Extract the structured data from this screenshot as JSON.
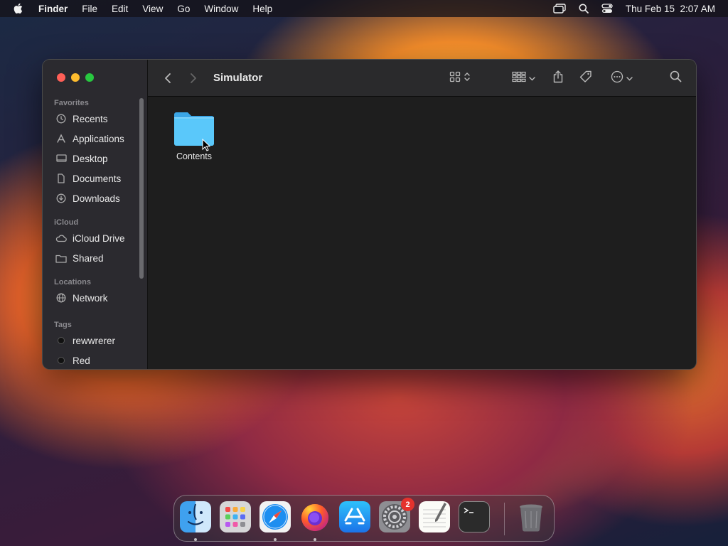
{
  "menubar": {
    "app_name": "Finder",
    "menus": [
      "File",
      "Edit",
      "View",
      "Go",
      "Window",
      "Help"
    ],
    "clock": "Thu Feb 15  2:07 AM",
    "status_icons": [
      "screen-mirroring-icon",
      "spotlight-icon",
      "control-center-icon"
    ]
  },
  "window": {
    "title": "Simulator",
    "sidebar": {
      "sections": [
        {
          "header": "Favorites",
          "items": [
            {
              "label": "Recents",
              "icon": "clock-icon"
            },
            {
              "label": "Applications",
              "icon": "applications-icon"
            },
            {
              "label": "Desktop",
              "icon": "desktop-icon"
            },
            {
              "label": "Documents",
              "icon": "document-icon"
            },
            {
              "label": "Downloads",
              "icon": "download-icon"
            }
          ]
        },
        {
          "header": "iCloud",
          "items": [
            {
              "label": "iCloud Drive",
              "icon": "cloud-icon"
            },
            {
              "label": "Shared",
              "icon": "shared-folder-icon"
            }
          ]
        },
        {
          "header": "Locations",
          "items": [
            {
              "label": "Network",
              "icon": "globe-icon"
            }
          ]
        },
        {
          "header": "Tags",
          "items": [
            {
              "label": "rewwrerer",
              "icon": "tag-dot"
            },
            {
              "label": "Red",
              "icon": "tag-dot"
            }
          ]
        }
      ]
    },
    "toolbar": {
      "icons": [
        "back-icon",
        "forward-icon",
        "icon-view-icon",
        "group-icon",
        "share-icon",
        "tag-icon",
        "more-actions-icon",
        "search-icon"
      ]
    },
    "files": [
      {
        "name": "Contents",
        "type": "folder"
      }
    ]
  },
  "dock": {
    "apps": [
      "Finder",
      "Launchpad",
      "Safari",
      "Firefox",
      "App Store",
      "System Settings",
      "TextEdit",
      "Terminal",
      "Trash"
    ],
    "running": [
      "Finder",
      "Safari",
      "Firefox"
    ],
    "system_settings_badge": "2"
  },
  "colors": {
    "window_bg": "#1f1f1f",
    "sidebar_bg": "#2b2a2f",
    "folder_blue": "#5ac8fa",
    "badge_red": "#e5322d"
  }
}
